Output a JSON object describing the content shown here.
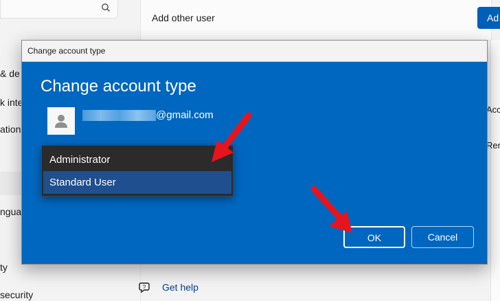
{
  "background": {
    "add_other_user_label": "Add other user",
    "add_button_label": "Ad",
    "nav_fragments": [
      "& de",
      "k inte",
      "ation",
      "nguag",
      "ty",
      "security"
    ],
    "right_fragments": [
      "Acc",
      "Rer"
    ],
    "get_help_label": "Get help"
  },
  "dialog": {
    "title": "Change account type",
    "heading": "Change account type",
    "email_suffix": "@gmail.com",
    "options": [
      "Administrator",
      "Standard User"
    ],
    "selected_option": "Standard User",
    "ok_label": "OK",
    "cancel_label": "Cancel"
  },
  "colors": {
    "dialog_bg": "#0067c0",
    "selected_item": "#1f4f8f",
    "annotation_arrow": "#e8141c"
  }
}
